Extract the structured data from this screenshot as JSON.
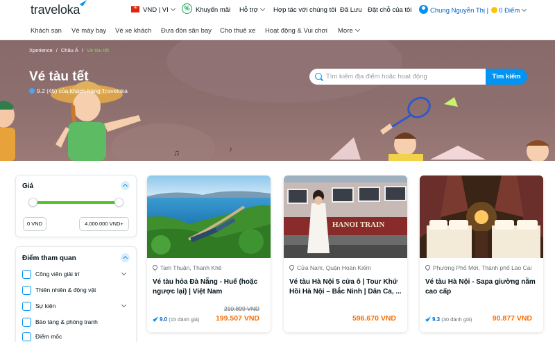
{
  "header": {
    "logo": "traveloka",
    "currency_lang": "VND | VI",
    "promo": "Khuyến mãi",
    "support": "Hỗ trợ",
    "partner": "Hợp tác với chúng tôi",
    "saved": "Đã Lưu",
    "bookings": "Đặt chỗ của tôi",
    "user_name": "Chung Nguyễn Thị",
    "points": "0 Điểm"
  },
  "nav": {
    "items": [
      "Khách sạn",
      "Vé máy bay",
      "Vé xe khách",
      "Đưa đón sân bay",
      "Cho thuê xe",
      "Hoạt động & Vui chơi",
      "More"
    ]
  },
  "hero": {
    "breadcrumb": [
      "Xperience",
      "Châu Á",
      "Vé tàu tết"
    ],
    "title": "Vé tàu tết",
    "rating": "9.2 (45) của khách hàng Traveloka",
    "search_placeholder": "Tìm kiếm địa điểm hoặc hoạt động",
    "search_button": "Tìm kiếm"
  },
  "filters": {
    "price": {
      "title": "Giá",
      "min": "0 VND",
      "max": "4.000.000 VND+"
    },
    "attractions": {
      "title": "Điểm tham quan",
      "items": [
        {
          "label": "Công viên giải trí",
          "expandable": true
        },
        {
          "label": "Thiên nhiên & động vật",
          "expandable": false
        },
        {
          "label": "Sự kiện",
          "expandable": true
        },
        {
          "label": "Bảo tàng & phòng tranh",
          "expandable": false
        },
        {
          "label": "Điểm mốc",
          "expandable": false
        }
      ]
    }
  },
  "products": [
    {
      "location": "Tam Thuận, Thanh Khê",
      "title": "Vé tàu hỏa Đà Nẵng - Huế (hoặc ngược lại) | Việt Nam",
      "old_price": "210.899 VND",
      "price": "199.507 VND",
      "rating": "9.0",
      "reviews": "(15 đánh giá)"
    },
    {
      "location": "Cửa Nam, Quận Hoàn Kiếm",
      "title": "Vé tàu Hà Nội 5 cửa ô | Tour Khứ Hồi Hà Nội – Bắc Ninh | Dân Ca, ...",
      "old_price": "",
      "price": "596.670 VND",
      "rating": "",
      "reviews": ""
    },
    {
      "location": "Phường Phố Mới, Thành phố Lào Cai",
      "title": "Vé tàu Hà Nội - Sapa giường nằm cao cấp",
      "old_price": "",
      "price": "90.877 VND",
      "rating": "9.3",
      "reviews": "(30 đánh giá)"
    }
  ],
  "train_sign": "HANOI TRAIN",
  "colors": {
    "primary": "#0194f3",
    "price": "#f96d01",
    "slider": "#54c42b",
    "hero_bg": "#8a6b6b"
  }
}
